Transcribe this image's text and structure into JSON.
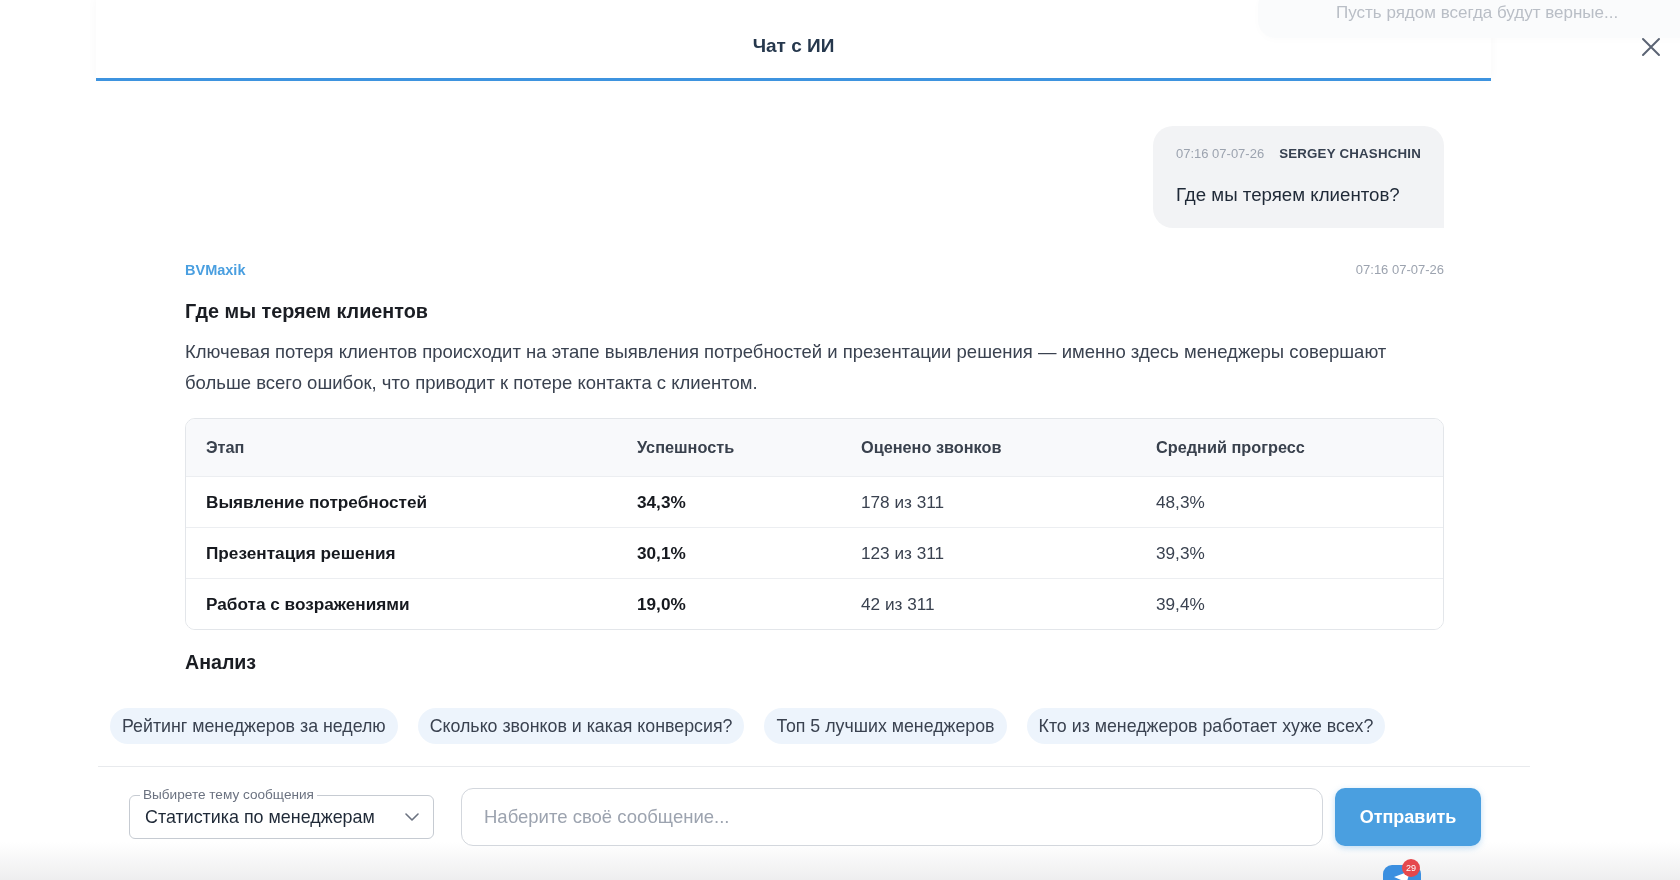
{
  "notification": {
    "text": "Пусть рядом всегда будут верные..."
  },
  "header": {
    "title": "Чат с ИИ"
  },
  "messages": [
    {
      "kind": "user",
      "time": "07:16 07-07-26",
      "author": "SERGEY CHASHCHIN",
      "text": "Где мы теряем клиентов?"
    },
    {
      "kind": "bot",
      "author": "BVMaxik",
      "time": "07:16 07-07-26",
      "heading": "Где мы теряем клиентов",
      "text": "Ключевая потеря клиентов происходит на этапе выявления потребностей и презентации решения — именно здесь менеджеры совершают больше всего ошибок, что приводит к потере контакта с клиентом.",
      "table": {
        "columns": [
          "Этап",
          "Успешность",
          "Оценено звонков",
          "Средний прогресс"
        ],
        "rows": [
          [
            "Выявление потребностей",
            "34,3%",
            "178 из 311",
            "48,3%"
          ],
          [
            "Презентация решения",
            "30,1%",
            "123 из 311",
            "39,3%"
          ],
          [
            "Работа с возражениями",
            "19,0%",
            "42 из 311",
            "39,4%"
          ]
        ]
      },
      "subheading": "Анализ"
    }
  ],
  "suggestions": [
    "Рейтинг менеджеров за неделю",
    "Сколько звонков и какая конверсия?",
    "Топ 5 лучших менеджеров",
    "Кто из менеджеров работает хуже всех?"
  ],
  "composer": {
    "topic_label": "Выбирете тему сообщения",
    "topic_value": "Статистика по менеджерам",
    "placeholder": "Наберите своё сообщение...",
    "send_button": "Отправить"
  },
  "widget": {
    "badge": "29"
  }
}
